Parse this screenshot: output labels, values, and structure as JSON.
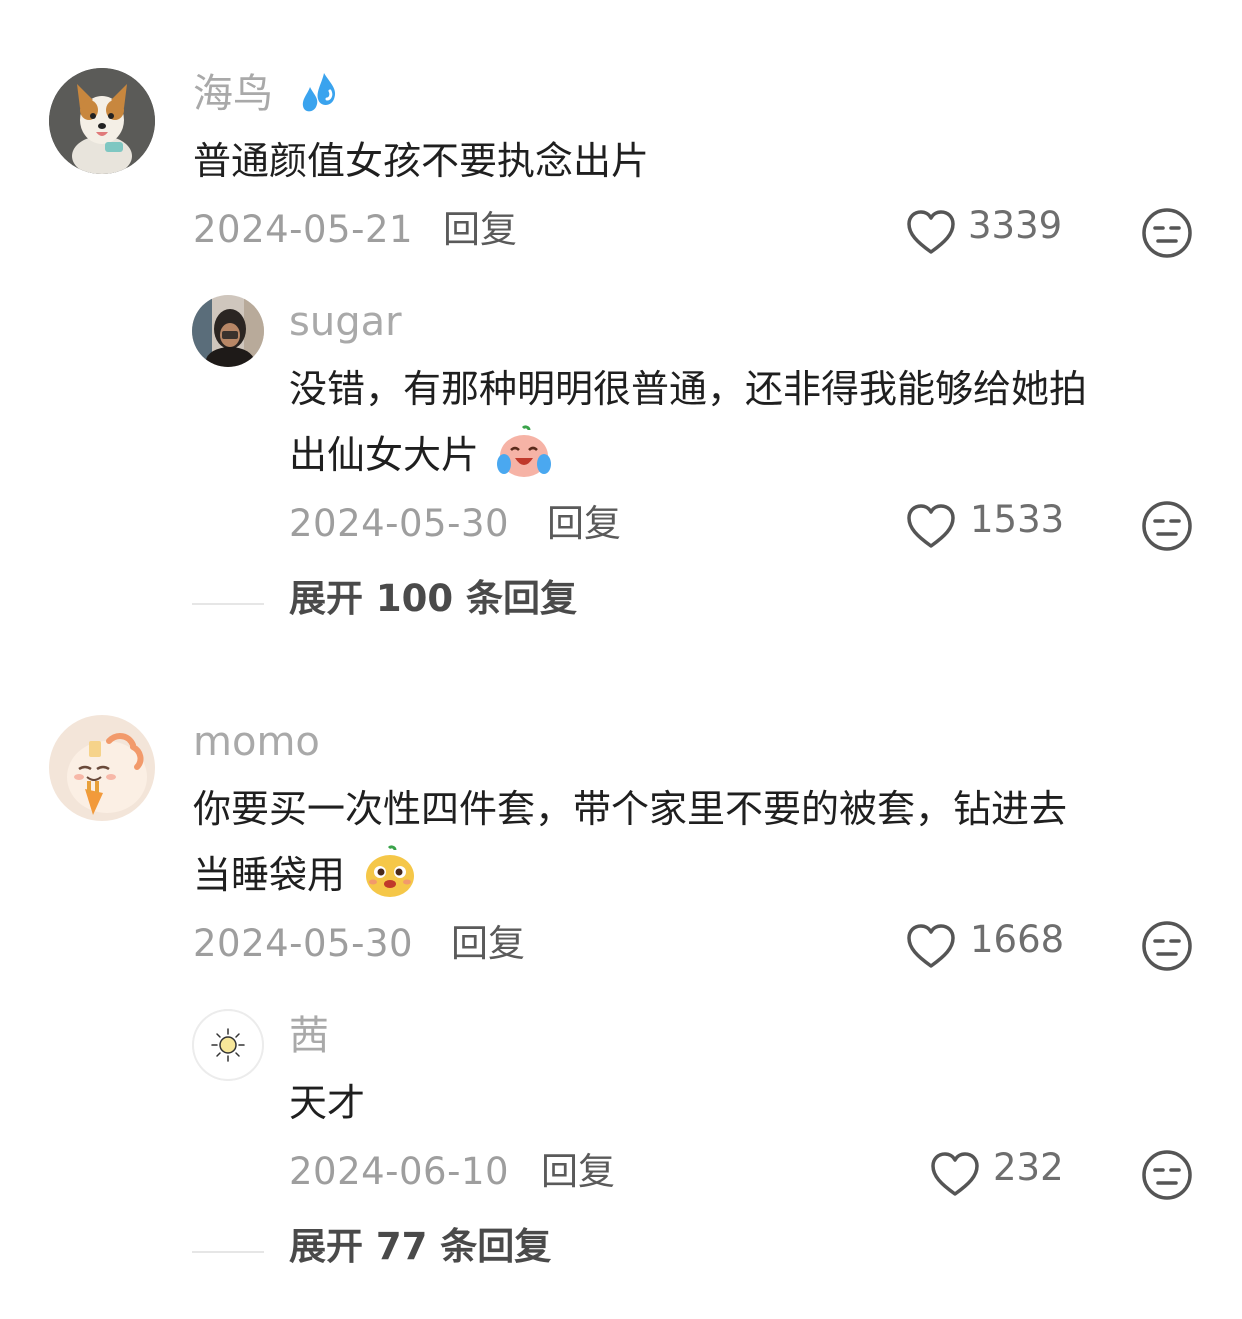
{
  "comments": [
    {
      "username": "海鸟",
      "username_icon": "sweat-droplets-icon",
      "content": "普通颜值女孩不要执念出片",
      "date": "2024-05-21",
      "reply_label": "回复",
      "likes": "3339",
      "replies": [
        {
          "username": "sugar",
          "content_line1": "没错，有那种明明很普通，还非得我能够给她拍",
          "content_line2": "出仙女大片",
          "content_emoji": "laughing-crying-face-icon",
          "date": "2024-05-30",
          "reply_label": "回复",
          "likes": "1533"
        }
      ],
      "expand_label": "展开 100 条回复"
    },
    {
      "username": "momo",
      "content_line1": "你要买一次性四件套，带个家里不要的被套，钻进去",
      "content_line2": "当睡袋用",
      "content_emoji": "smirking-face-icon",
      "date": "2024-05-30",
      "reply_label": "回复",
      "likes": "1668",
      "replies": [
        {
          "username": "茜",
          "content": "天才",
          "date": "2024-06-10",
          "reply_label": "回复",
          "likes": "232"
        }
      ],
      "expand_label": "展开 77 条回复"
    }
  ],
  "colors": {
    "username": "#a9a9a9",
    "content": "#1f1f1f",
    "meta": "#9e9e9e",
    "icon_stroke": "#555555",
    "divider": "#e6e6e6"
  }
}
